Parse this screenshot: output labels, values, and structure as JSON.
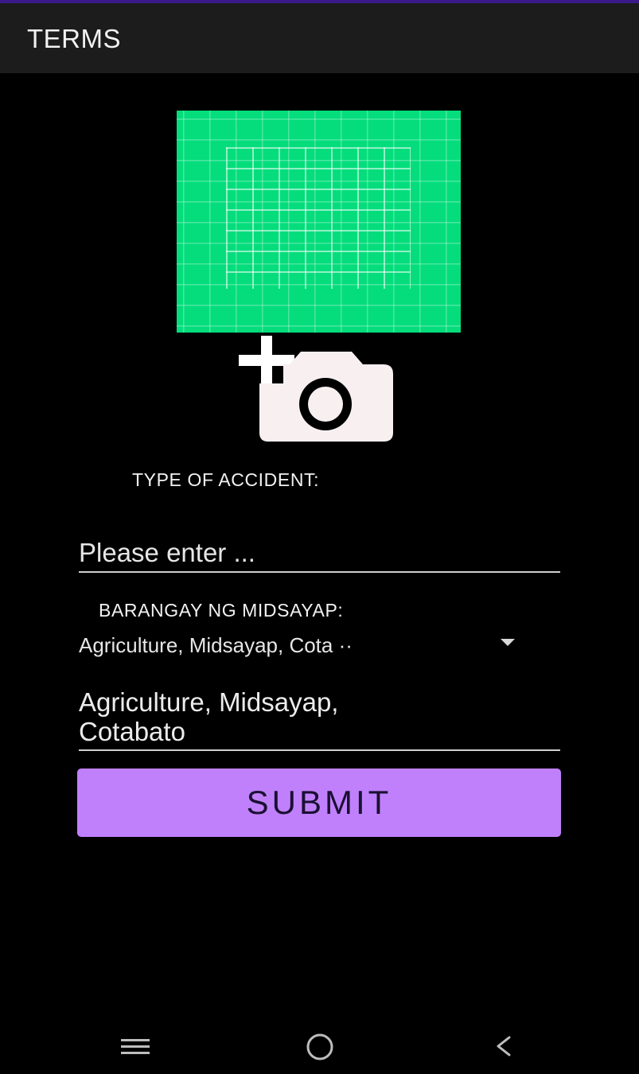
{
  "app_bar": {
    "title": "TERMS"
  },
  "photo": {
    "preview_color": "#05dd7c",
    "add_photo_icon": "add-a-photo-icon"
  },
  "form": {
    "accident_label": "TYPE OF ACCIDENT:",
    "accident_placeholder": "Please enter ...",
    "accident_value": "",
    "barangay_label": "BARANGAY NG MIDSAYAP:",
    "barangay_selected": "Agriculture, Midsayap, Cota ··",
    "address_line1": "Agriculture, Midsayap,",
    "address_line2": "Cotabato",
    "submit_label": "SUBMIT"
  },
  "colors": {
    "background": "#000000",
    "app_bar": "#1c1c1c",
    "submit_button": "#c180fb",
    "accent_top": "#3a1a8a"
  },
  "nav_bar": {
    "icons": [
      "recents-icon",
      "home-icon",
      "back-icon"
    ]
  }
}
